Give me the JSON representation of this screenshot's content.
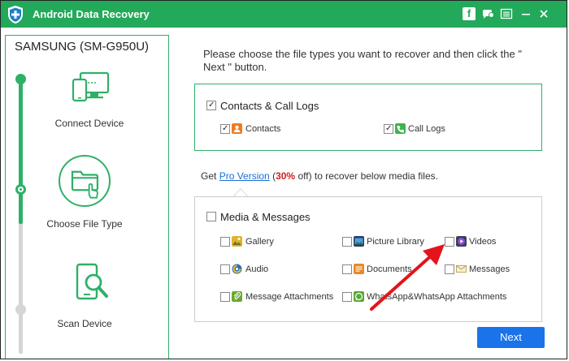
{
  "window": {
    "title": "Android Data Recovery",
    "accent_color": "#23a95a",
    "titlebar_icons": [
      "facebook-icon",
      "chat-icon",
      "menu-icon",
      "minimize-icon",
      "close-icon"
    ]
  },
  "sidebar": {
    "device": "SAMSUNG (SM-G950U)",
    "steps": [
      {
        "label": "Connect Device",
        "icon": "connect-device-icon",
        "state": "done"
      },
      {
        "label": "Choose File Type",
        "icon": "folder-touch-icon",
        "state": "current"
      },
      {
        "label": "Scan Device",
        "icon": "scan-phone-icon",
        "state": "pending"
      }
    ]
  },
  "main": {
    "instruction": "Please choose the file types you want to recover and then click the \" Next \" button.",
    "contacts_group": {
      "label": "Contacts & Call Logs",
      "checked": true,
      "items": [
        {
          "label": "Contacts",
          "checked": true,
          "icon": "contacts-icon"
        },
        {
          "label": "Call Logs",
          "checked": true,
          "icon": "call-logs-icon"
        }
      ]
    },
    "promo": {
      "prefix": "Get ",
      "link": "Pro Version",
      "open": " (",
      "percent": "30%",
      "suffix": " off) to recover below media files."
    },
    "media_group": {
      "label": "Media & Messages",
      "checked": false,
      "items": [
        {
          "label": "Gallery",
          "checked": false,
          "icon": "gallery-icon"
        },
        {
          "label": "Picture Library",
          "checked": false,
          "icon": "picture-library-icon"
        },
        {
          "label": "Videos",
          "checked": false,
          "icon": "videos-icon"
        },
        {
          "label": "Audio",
          "checked": false,
          "icon": "audio-icon"
        },
        {
          "label": "Documents",
          "checked": false,
          "icon": "documents-icon"
        },
        {
          "label": "Messages",
          "checked": false,
          "icon": "messages-icon"
        },
        {
          "label": "Message Attachments",
          "checked": false,
          "icon": "message-attachments-icon"
        },
        {
          "label": "WhatsApp&WhatsApp Attachments",
          "checked": false,
          "icon": "whatsapp-icon"
        }
      ]
    },
    "next_label": "Next"
  }
}
